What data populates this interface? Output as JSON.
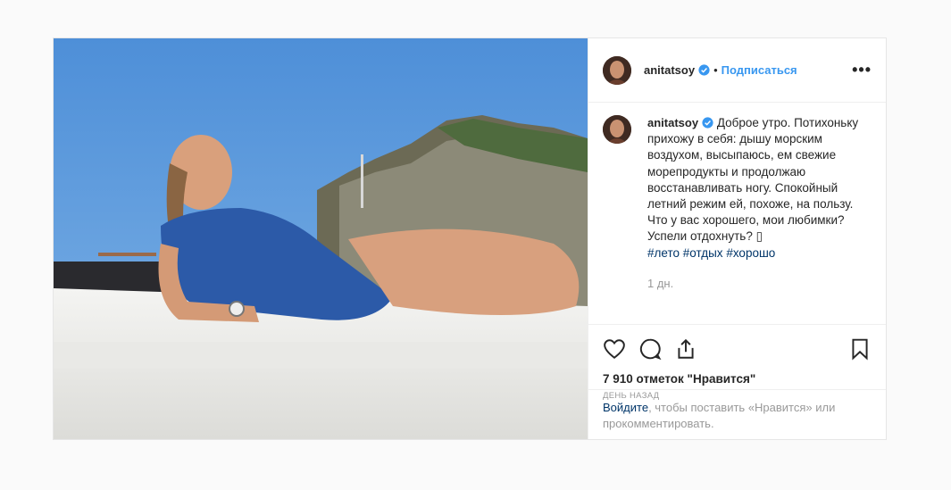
{
  "post": {
    "username": "anitatsoy",
    "follow_label": "Подписаться",
    "separator": "•",
    "more_label": "•••",
    "caption_text": "Доброе утро. Потихоньку прихожу в себя: дышу морским воздухом, высыпаюсь, ем свежие морепродукты и продолжаю восстанавливать ногу. Спокойный летний режим ей, похоже, на пользу. Что у вас хорошего, мои любимки? Успели отдохнуть? ",
    "emoji_glyph": "▯",
    "hashtags": [
      "#лето",
      "#отдых",
      "#хорошо"
    ],
    "time_ago": "1 дн.",
    "likes_text": "7 910 отметок \"Нравится\"",
    "date_label": "день назад",
    "login_link": "Войдите",
    "login_rest": ", чтобы поставить «Нравится» или прокомментировать."
  },
  "icons": {
    "verified": "verified-badge-icon",
    "like": "heart-icon",
    "comment": "comment-bubble-icon",
    "share": "share-icon",
    "save": "bookmark-icon",
    "more": "more-options-icon"
  },
  "colors": {
    "link_blue": "#3897f0",
    "hashtag": "#003569",
    "muted": "#999999",
    "border": "#efefef"
  }
}
